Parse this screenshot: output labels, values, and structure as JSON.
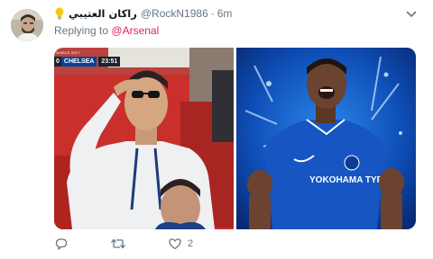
{
  "tweet": {
    "display_name": "راكان العتيبي",
    "handle": "@RockN1986",
    "separator": "·",
    "time": "6m",
    "replying_prefix": "Replying to",
    "replying_to": "@Arsenal",
    "icons": {
      "name_emoji": "lightbulb-icon",
      "more": "chevron-down-icon",
      "reply": "reply-icon",
      "retweet": "retweet-icon",
      "like": "heart-icon"
    },
    "like_count": "2",
    "media": {
      "left": {
        "scorebug": {
          "caption": "SHIELD 2017",
          "score": "0",
          "team": "CHELSEA",
          "clock": "23:51"
        }
      },
      "right": {
        "sponsor": "YOKOHAMA TYRES"
      }
    }
  },
  "colors": {
    "text_primary": "#14171a",
    "text_secondary": "#657786",
    "link": "#e0245e",
    "chelsea_blue": "#0a4595"
  }
}
